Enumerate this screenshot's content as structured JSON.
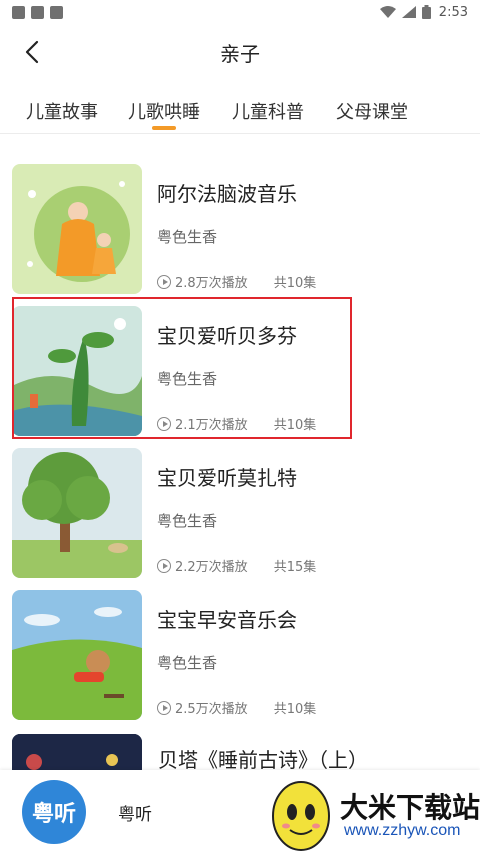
{
  "status_bar": {
    "time": "2:53"
  },
  "nav": {
    "title": "亲子"
  },
  "tabs": [
    {
      "label": "儿童故事"
    },
    {
      "label": "儿歌哄睡",
      "active": true
    },
    {
      "label": "儿童科普"
    },
    {
      "label": "父母课堂"
    }
  ],
  "albums": [
    {
      "title": "阿尔法脑波音乐",
      "author": "粤色生香",
      "plays": "2.8万次播放",
      "episodes": "共10集"
    },
    {
      "title": "宝贝爱听贝多芬",
      "author": "粤色生香",
      "plays": "2.1万次播放",
      "episodes": "共10集"
    },
    {
      "title": "宝贝爱听莫扎特",
      "author": "粤色生香",
      "plays": "2.2万次播放",
      "episodes": "共15集"
    },
    {
      "title": "宝宝早安音乐会",
      "author": "粤色生香",
      "plays": "2.5万次播放",
      "episodes": "共10集"
    },
    {
      "title": "贝塔《睡前古诗》（上）"
    }
  ],
  "bottom": {
    "logo_text": "粤听",
    "app_name": "粤听"
  },
  "watermark": {
    "title": "大米下载站",
    "url": "www.zzhyw.com"
  },
  "colors": {
    "accent": "#f39a28",
    "highlight": "#e0262d",
    "logo_blue": "#2f86d8"
  }
}
